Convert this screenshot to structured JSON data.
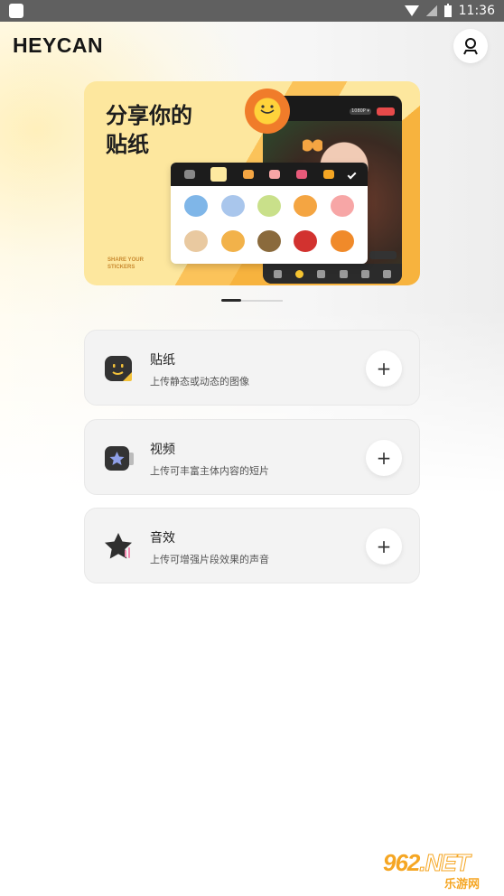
{
  "status_bar": {
    "time": "11:36"
  },
  "header": {
    "logo": "HEYCAN"
  },
  "banner": {
    "title_line1": "分享你的",
    "title_line2": "贴纸",
    "subtitle_line1": "SHARE YOUR",
    "subtitle_line2": "STICKERS",
    "phone_pill": "1080P ▾",
    "active_slide": 1
  },
  "cards": [
    {
      "title": "贴纸",
      "desc": "上传静态或动态的图像",
      "action": "+"
    },
    {
      "title": "视频",
      "desc": "上传可丰富主体内容的短片",
      "action": "+"
    },
    {
      "title": "音效",
      "desc": "上传可增强片段效果的声音",
      "action": "+"
    }
  ],
  "watermark": {
    "brand": "962",
    "tld": ".NET",
    "sub": "乐游网"
  },
  "colors": {
    "banner_bg": "#fde79e",
    "banner_accent": "#f7b33e",
    "card_bg": "#f3f3f3",
    "text_primary": "#1f1f1f",
    "watermark": "#f5a623"
  }
}
